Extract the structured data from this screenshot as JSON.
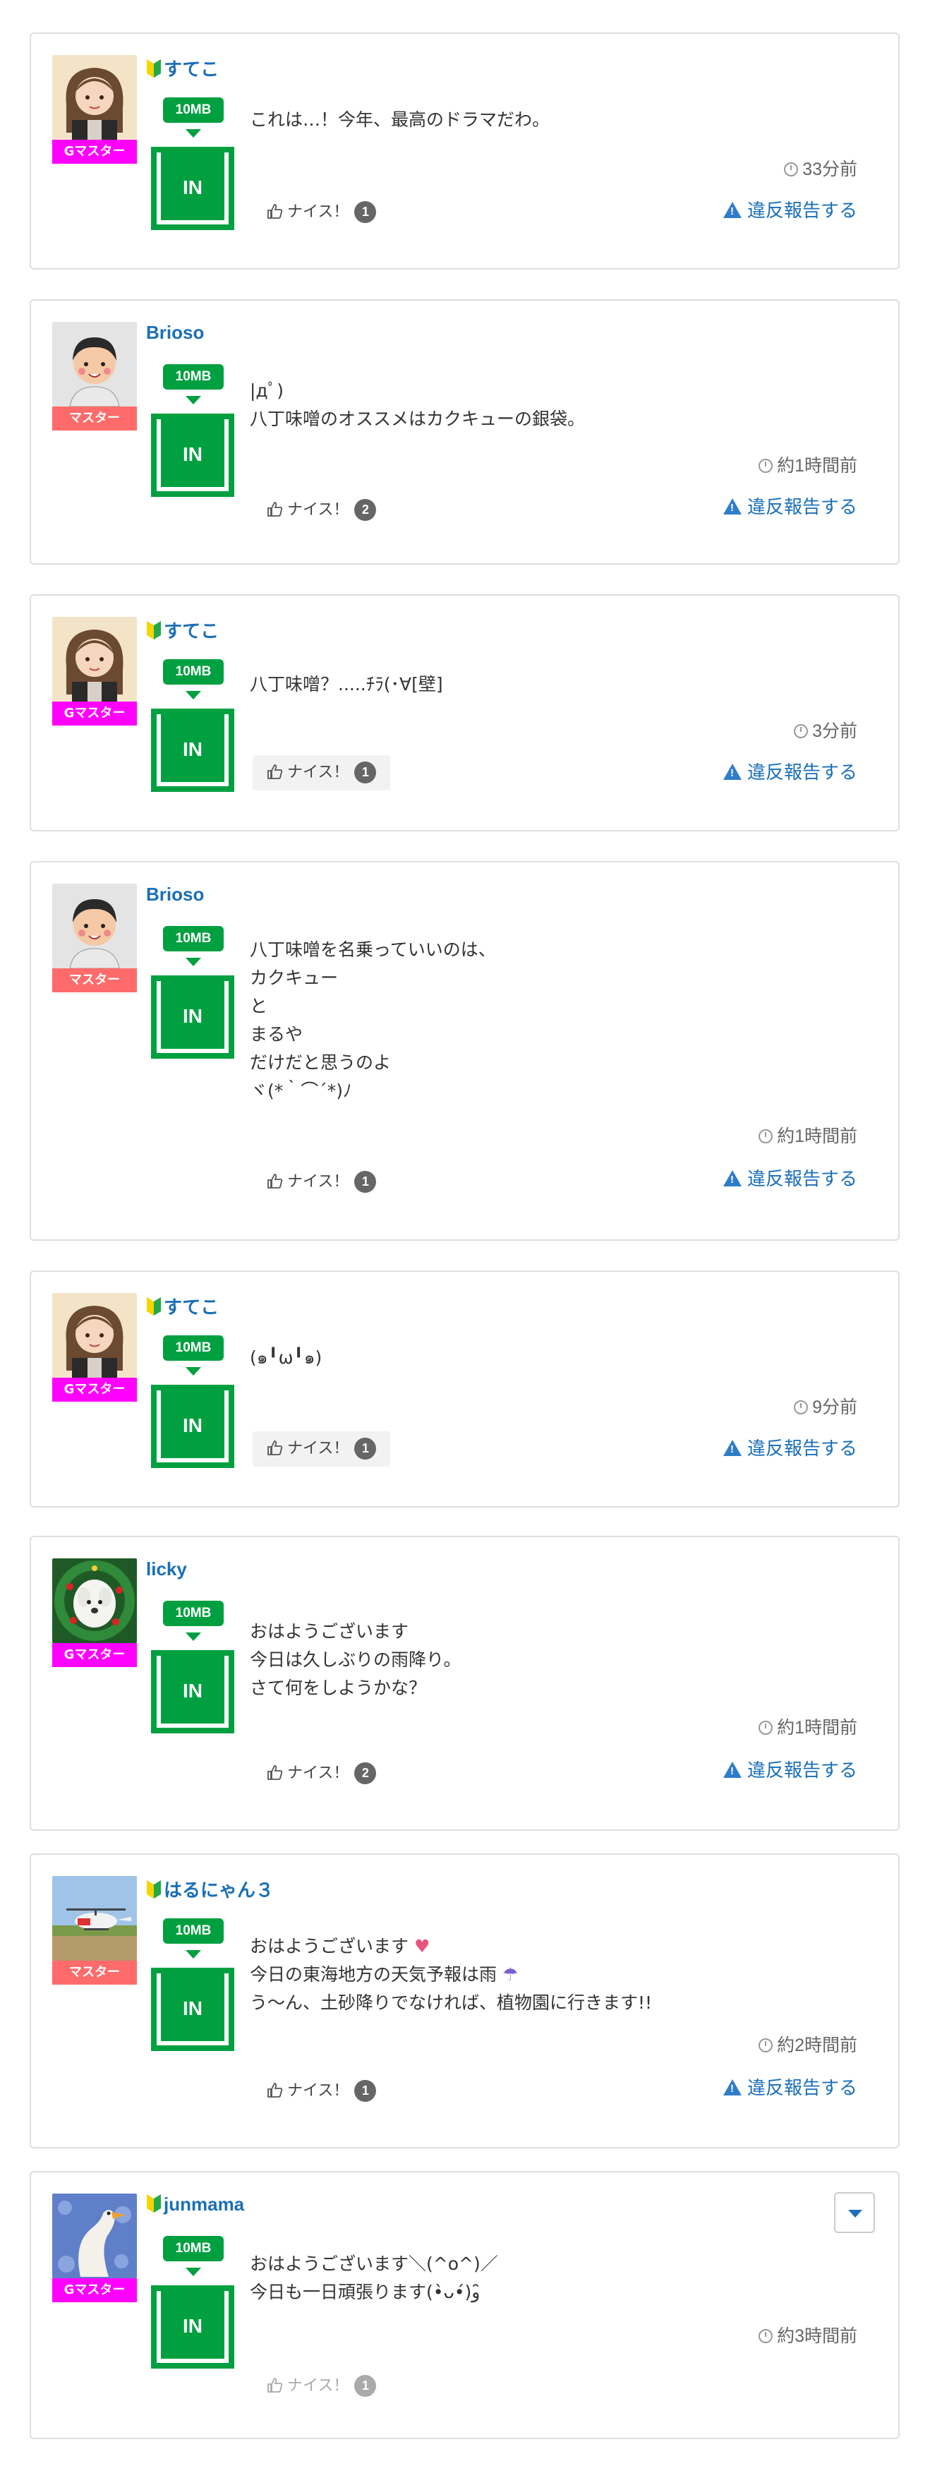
{
  "like_label": "ナイス！",
  "report_label": "違反報告する",
  "size_badge": "10MB",
  "in_label": "IN",
  "posts": [
    {
      "user": "すてこ",
      "beginner": true,
      "role": "Gマスター",
      "avatar": "avatar-sutekko",
      "text": "これは…！今年、最高のドラマだわ。",
      "time": "33分前",
      "nice_count": "1"
    },
    {
      "user": "Brioso",
      "beginner": false,
      "role": "マスター",
      "avatar": "avatar-brioso",
      "text": "|дﾟ)\n八丁味噌のオススメはカクキューの銀袋。",
      "time": "約1時間前",
      "nice_count": "2"
    },
    {
      "user": "すてこ",
      "beginner": true,
      "role": "Gマスター",
      "avatar": "avatar-sutekko",
      "text": "八丁味噌？.....ﾁﾗ(･∀[壁]",
      "time": "3分前",
      "nice_count": "1"
    },
    {
      "user": "Brioso",
      "beginner": false,
      "role": "マスター",
      "avatar": "avatar-brioso",
      "text": "八丁味噌を名乗っていいのは、\nカクキュー\nと\nまるや\nだけだと思うのよ\nヾ(*｀⌒´*)ﾉ",
      "time": "約1時間前",
      "nice_count": "1"
    },
    {
      "user": "すてこ",
      "beginner": true,
      "role": "Gマスター",
      "avatar": "avatar-sutekko",
      "text": "(๑╹ω╹๑)",
      "time": "9分前",
      "nice_count": "1"
    },
    {
      "user": "licky",
      "beginner": false,
      "role": "Gマスター",
      "avatar": "avatar-licky",
      "text": "おはようございます\n今日は久しぶりの雨降り。\nさて何をしようかな？",
      "time": "約1時間前",
      "nice_count": "2"
    },
    {
      "user": "はるにゃん３",
      "beginner": true,
      "role": "マスター",
      "avatar": "avatar-harunyan",
      "text_lines": [
        "おはようございます",
        "今日の東海地方の天気予報は雨",
        "う〜ん、土砂降りでなければ、植物園に行きます!!"
      ],
      "time": "約2時間前",
      "nice_count": "1"
    },
    {
      "user": "junmama",
      "beginner": true,
      "role": "Gマスター",
      "avatar": "avatar-junmama",
      "text": "おはようございます＼(^o^)／\n今日も一日頑張ります(•̀ᴗ•́)و ̑̑",
      "time": "約3時間前",
      "nice_count": "1"
    }
  ],
  "colors": {
    "accent": "#1a6fb8",
    "in_green": "#00a040",
    "g_master": "#ff00ff",
    "master": "#ff6b6b"
  }
}
